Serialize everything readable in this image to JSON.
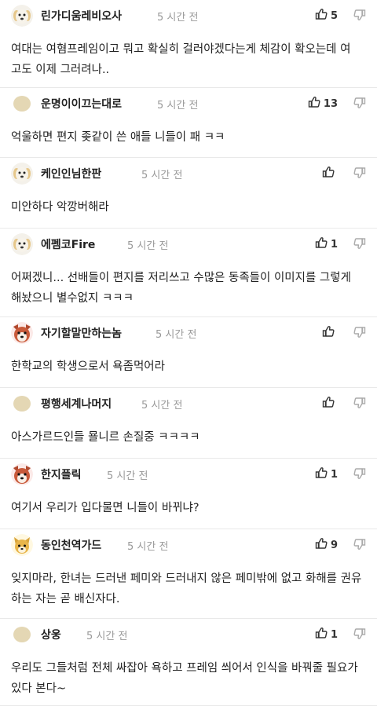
{
  "comments": [
    {
      "nick": "린가디움레비오사",
      "time": "5 시간 전",
      "likes": "5",
      "avatar": "dog",
      "body": "여대는 여혐프레임이고 뭐고 확실히 걸러야겠다는게 체감이 확오는데 여고도 이제 그러려나.."
    },
    {
      "nick": "운명이이끄는대로",
      "time": "5 시간 전",
      "likes": "13",
      "avatar": "blank",
      "body": "억울하면 편지 좆같이 쓴 애들 니들이 패 ㅋㅋ"
    },
    {
      "nick": "케인인님한판",
      "time": "5 시간 전",
      "likes": "",
      "avatar": "dog",
      "body": "미안하다 악깡버해라"
    },
    {
      "nick": "에펨코Fire",
      "time": "5 시간 전",
      "likes": "1",
      "avatar": "dog",
      "body": "어쩌겠니... 선배들이 편지를 저리쓰고 수많은 동족들이 이미지를 그렇게 해놨으니 별수없지 ㅋㅋㅋ"
    },
    {
      "nick": "자기할말만하는놈",
      "time": "5 시간 전",
      "likes": "",
      "avatar": "shiba",
      "body": "한학교의 학생으로서 욕좀먹어라"
    },
    {
      "nick": "평행세계나머지",
      "time": "5 시간 전",
      "likes": "",
      "avatar": "blank",
      "body": "아스가르드인들 묠니르 손질중 ㅋㅋㅋㅋ"
    },
    {
      "nick": "한지플릭",
      "time": "5 시간 전",
      "likes": "1",
      "avatar": "shiba",
      "body": "여기서 우리가 입다물면 니들이 바뀌냐?"
    },
    {
      "nick": "동인천역가드",
      "time": "5 시간 전",
      "likes": "9",
      "avatar": "cat",
      "body": "잊지마라, 한녀는 드러낸 페미와 드러내지 않은 페미밖에 없고 화해를 권유하는 자는 곧 배신자다."
    },
    {
      "nick": "상웅",
      "time": "5 시간 전",
      "likes": "1",
      "avatar": "blank",
      "body": "우리도 그들처럼 전체 싸잡아 욕하고 프레임 씌어서 인식을 바꿔줄 필요가 있다 본다~"
    }
  ]
}
